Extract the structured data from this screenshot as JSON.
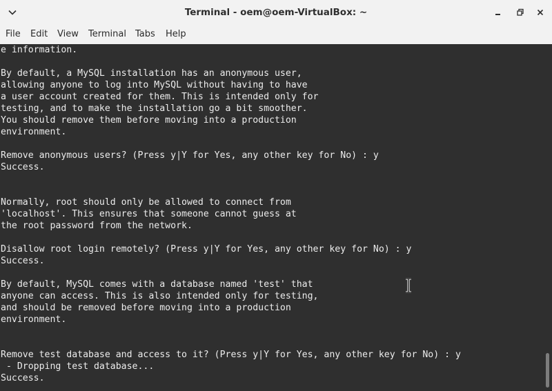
{
  "window": {
    "title": "Terminal - oem@oem-VirtualBox: ~"
  },
  "icons": {
    "window_menu": "chevron-down-icon",
    "minimize": "minimize-icon",
    "maximize": "maximize-icon",
    "close": "close-icon",
    "pointer": "text-cursor-icon"
  },
  "menubar": {
    "items": [
      {
        "label": "File"
      },
      {
        "label": "Edit"
      },
      {
        "label": "View"
      },
      {
        "label": "Terminal"
      },
      {
        "label": "Tabs"
      },
      {
        "label": "Help"
      }
    ]
  },
  "colors": {
    "terminal_background": "#2f2f2f",
    "terminal_text": "#ececec",
    "chrome": "#f2f2f2"
  },
  "terminal": {
    "lines": [
      "e information.",
      "",
      "By default, a MySQL installation has an anonymous user,",
      "allowing anyone to log into MySQL without having to have",
      "a user account created for them. This is intended only for",
      "testing, and to make the installation go a bit smoother.",
      "You should remove them before moving into a production",
      "environment.",
      "",
      "Remove anonymous users? (Press y|Y for Yes, any other key for No) : y",
      "Success.",
      "",
      "",
      "Normally, root should only be allowed to connect from",
      "'localhost'. This ensures that someone cannot guess at",
      "the root password from the network.",
      "",
      "Disallow root login remotely? (Press y|Y for Yes, any other key for No) : y",
      "Success.",
      "",
      "By default, MySQL comes with a database named 'test' that",
      "anyone can access. This is also intended only for testing,",
      "and should be removed before moving into a production",
      "environment.",
      "",
      "",
      "Remove test database and access to it? (Press y|Y for Yes, any other key for No) : y",
      " - Dropping test database...",
      "Success."
    ]
  }
}
